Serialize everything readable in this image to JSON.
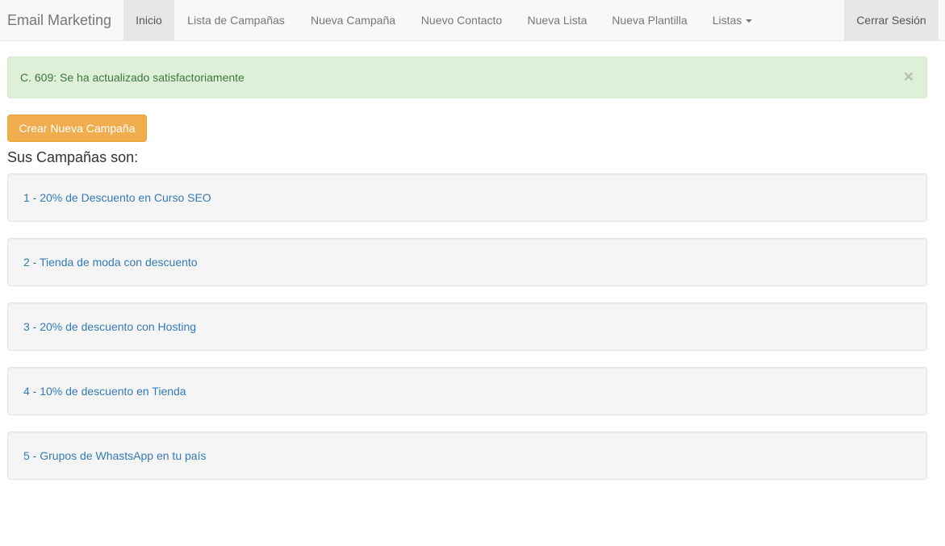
{
  "navbar": {
    "brand": "Email Marketing",
    "items": [
      {
        "label": "Inicio"
      },
      {
        "label": "Lista de Campañas"
      },
      {
        "label": "Nueva Campaña"
      },
      {
        "label": "Nuevo Contacto"
      },
      {
        "label": "Nueva Lista"
      },
      {
        "label": "Nueva Plantilla"
      },
      {
        "label": "Listas"
      }
    ],
    "logout": "Cerrar Sesión",
    "active_item": "Inicio"
  },
  "alert": {
    "message": "C. 609: Se ha actualizado satisfactoriamente",
    "close_symbol": "×"
  },
  "actions": {
    "new_campaign_label": "Crear Nueva Campaña"
  },
  "campaigns": {
    "heading": "Sus Campañas son:",
    "items": [
      {
        "label": "1 - 20% de Descuento en Curso SEO"
      },
      {
        "label": "2 - Tienda de moda con descuento"
      },
      {
        "label": "3 - 20% de descuento con Hosting"
      },
      {
        "label": "4 - 10% de descuento en Tienda"
      },
      {
        "label": "5 - Grupos de WhastsApp en tu país"
      }
    ]
  },
  "colors": {
    "navbar_bg": "#f8f8f8",
    "alert_success_bg": "#dff0d8",
    "alert_success_text": "#3c763d",
    "button_warning": "#f0ad4e",
    "link": "#337ab7",
    "well_bg": "#f5f5f5"
  },
  "icons": {
    "dropdown": "caret-down-icon",
    "close": "close-icon"
  }
}
